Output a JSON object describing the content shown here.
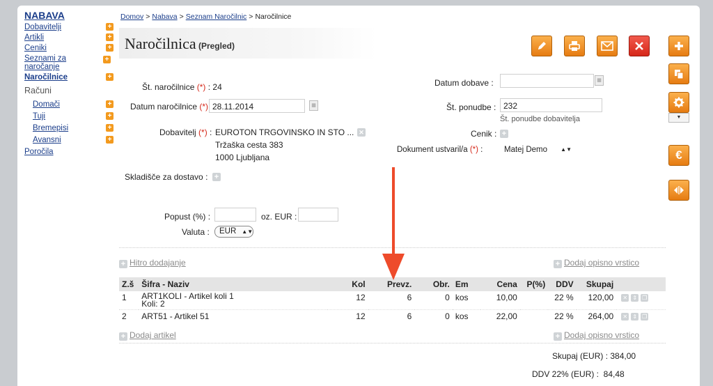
{
  "sidebar": {
    "title": "NABAVA",
    "items": [
      {
        "label": "Dobavitelji",
        "bold": false
      },
      {
        "label": "Artikli",
        "bold": false
      },
      {
        "label": "Ceniki",
        "bold": false
      },
      {
        "label": "Seznami za naročanje",
        "bold": false
      },
      {
        "label": "Naročilnice",
        "bold": true
      }
    ],
    "racuni_label": "Računi",
    "sub_items": [
      {
        "label": "Domači"
      },
      {
        "label": "Tuji"
      },
      {
        "label": "Bremepisi"
      },
      {
        "label": "Avansni"
      }
    ],
    "porocila": "Poročila"
  },
  "breadcrumb": {
    "items": [
      "Domov",
      "Nabava",
      "Seznam Naročilnic"
    ],
    "current": "Naročilnice"
  },
  "header": {
    "title": "Naročilnica",
    "subtitle": "(Pregled)"
  },
  "form": {
    "st_narocilnice_label": "Št. naročilnice",
    "st_narocilnice_value": "24",
    "datum_narocilnice_label": "Datum naročilnice",
    "datum_narocilnice_value": "28.11.2014",
    "dobavitelj_label": "Dobavitelj",
    "dobavitelj_value": "EUROTON TRGOVINSKO IN STO ...",
    "dobavitelj_address1": "Tržaška cesta 383",
    "dobavitelj_address2": "1000 Ljubljana",
    "skladisce_label": "Skladišče za dostavo :",
    "datum_dobave_label": "Datum dobave :",
    "datum_dobave_value": "",
    "st_ponudbe_label": "Št. ponudbe :",
    "st_ponudbe_value": "232",
    "st_ponudbe_hint": "Št. ponudbe dobavitelja",
    "cenik_label": "Cenik :",
    "dokument_label": "Dokument ustvaril/a",
    "dokument_value": "Matej Demo",
    "popust_label": "Popust (%) :",
    "oz_eur_label": "oz. EUR :",
    "valuta_label": "Valuta :",
    "valuta_value": "EUR",
    "required_marker": "(*)"
  },
  "links": {
    "hitro_dodajanje": "Hitro dodajanje",
    "dodaj_opisno_vrstico": "Dodaj opisno vrstico",
    "dodaj_artikel": "Dodaj artikel"
  },
  "table": {
    "headers": [
      "Z.š",
      "Šifra - Naziv",
      "Kol",
      "Prevz.",
      "Obr.",
      "Em",
      "Cena",
      "P(%)",
      "DDV",
      "Skupaj"
    ],
    "rows": [
      {
        "zs": "1",
        "naziv": "ART1KOLI - Artikel koli 1",
        "naziv2": "Koli: 2",
        "kol": "12",
        "prevz": "6",
        "obr": "0",
        "em": "kos",
        "cena": "10,00",
        "p": "",
        "ddv": "22 %",
        "skupaj": "120,00"
      },
      {
        "zs": "2",
        "naziv": "ART51 - Artikel 51",
        "naziv2": "",
        "kol": "12",
        "prevz": "6",
        "obr": "0",
        "em": "kos",
        "cena": "22,00",
        "p": "",
        "ddv": "22 %",
        "skupaj": "264,00"
      }
    ]
  },
  "totals": {
    "skupaj": "Skupaj (EUR) : 384,00",
    "ddv": "DDV 22% (EUR) :  84,48"
  },
  "colors": {
    "accent_orange": "#f39a1e",
    "accent_red": "#d52719",
    "link_blue": "#1a3d8a"
  },
  "icons": {
    "edit": "pencil-icon",
    "print": "print-icon",
    "email": "envelope-icon",
    "delete": "close-icon",
    "add": "plus-icon",
    "copy": "copy-icon",
    "settings": "gear-icon",
    "currency": "euro-icon",
    "split": "split-arrows-icon"
  }
}
